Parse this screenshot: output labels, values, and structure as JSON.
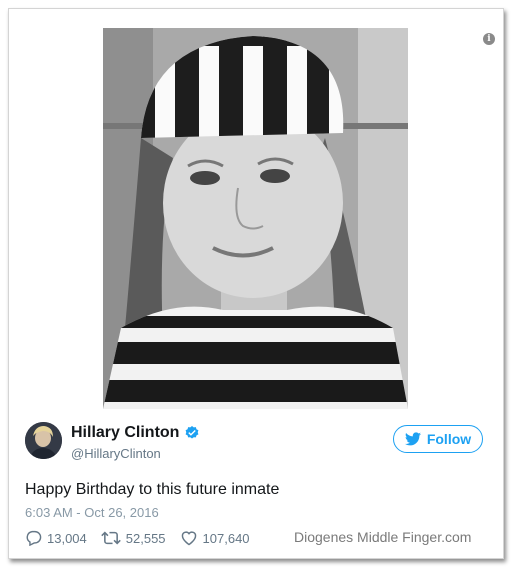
{
  "tweet": {
    "author_name": "Hillary Clinton",
    "handle": "@HillaryClinton",
    "follow_label": "Follow",
    "text": "Happy Birthday to this future inmate",
    "timestamp": "6:03 AM - Oct 26, 2016",
    "replies": "13,004",
    "retweets": "52,555",
    "likes": "107,640",
    "verified": true
  },
  "watermark": "Diogenes Middle Finger.com",
  "icons": {
    "info": "info-icon",
    "verified": "verified-badge-icon",
    "follow": "twitter-bird-icon",
    "reply": "reply-icon",
    "retweet": "retweet-icon",
    "like": "heart-icon"
  },
  "colors": {
    "twitter_blue": "#1da1f2",
    "text": "#14171a",
    "muted": "#657786"
  }
}
